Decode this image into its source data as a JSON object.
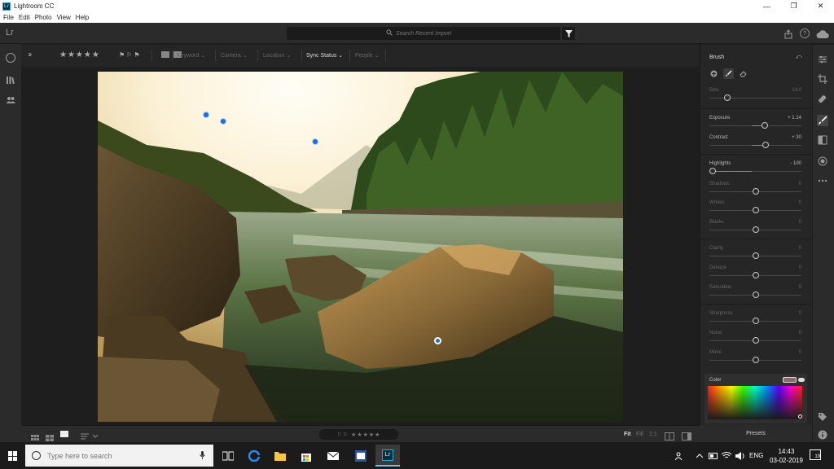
{
  "window": {
    "app_name": "Lightroom CC",
    "logo_text": "Lr",
    "controls": [
      "—",
      "❐",
      "✕"
    ]
  },
  "menu": [
    "File",
    "Edit",
    "Photo",
    "View",
    "Help"
  ],
  "header": {
    "lr_mark": "Lr",
    "search_placeholder": "Search Recent Import"
  },
  "filterbar": {
    "rating_op": "≥",
    "stars": "★★★★★",
    "flags": "⚑⚐⚑",
    "keyword": "Keyword ⌄",
    "camera": "Camera ⌄",
    "location": "Location ⌄",
    "sync_status": "Sync Status ⌄",
    "people": "People ⌄"
  },
  "panel": {
    "title": "Brush",
    "reset_icon": "⤺",
    "size": {
      "label": "Size",
      "value": "13.0",
      "level": 0.17
    },
    "sliders": [
      {
        "label": "Exposure",
        "value": "+ 1.14",
        "level": 0.61,
        "lit": true
      },
      {
        "label": "Contrast",
        "value": "+ 30",
        "level": 0.62,
        "lit": true
      },
      {
        "label": "Highlights",
        "value": "- 100",
        "level": 0.0,
        "lit": true
      },
      {
        "label": "Shadows",
        "value": "0",
        "level": 0.5,
        "lit": false
      },
      {
        "label": "Whites",
        "value": "0",
        "level": 0.5,
        "lit": false
      },
      {
        "label": "Blacks",
        "value": "0",
        "level": 0.5,
        "lit": false
      },
      {
        "label": "Clarity",
        "value": "0",
        "level": 0.5,
        "lit": false
      },
      {
        "label": "Dehaze",
        "value": "0",
        "level": 0.5,
        "lit": false
      },
      {
        "label": "Saturation",
        "value": "0",
        "level": 0.5,
        "lit": false
      },
      {
        "label": "Sharpness",
        "value": "0",
        "level": 0.5,
        "lit": false
      },
      {
        "label": "Noise",
        "value": "0",
        "level": 0.5,
        "lit": false
      },
      {
        "label": "Moiré",
        "value": "0",
        "level": 0.5,
        "lit": false
      }
    ],
    "color_label": "Color",
    "swatch_color": "#8a6a6a",
    "presets": "Presets"
  },
  "bottombar": {
    "rating_widget": "⚐⚐ ★★★★★",
    "zoom_fit": "Fit",
    "zoom_fill": "Fill",
    "zoom_1to1": "1:1"
  },
  "taskbar": {
    "search_placeholder": "Type here to search",
    "language": "ENG",
    "time": "14:43",
    "date": "03-02-2019",
    "notifications": "19"
  },
  "colors": {
    "accent": "#1c6ee0",
    "panel_bg": "#262626",
    "app_bg": "#1e1e1e"
  }
}
